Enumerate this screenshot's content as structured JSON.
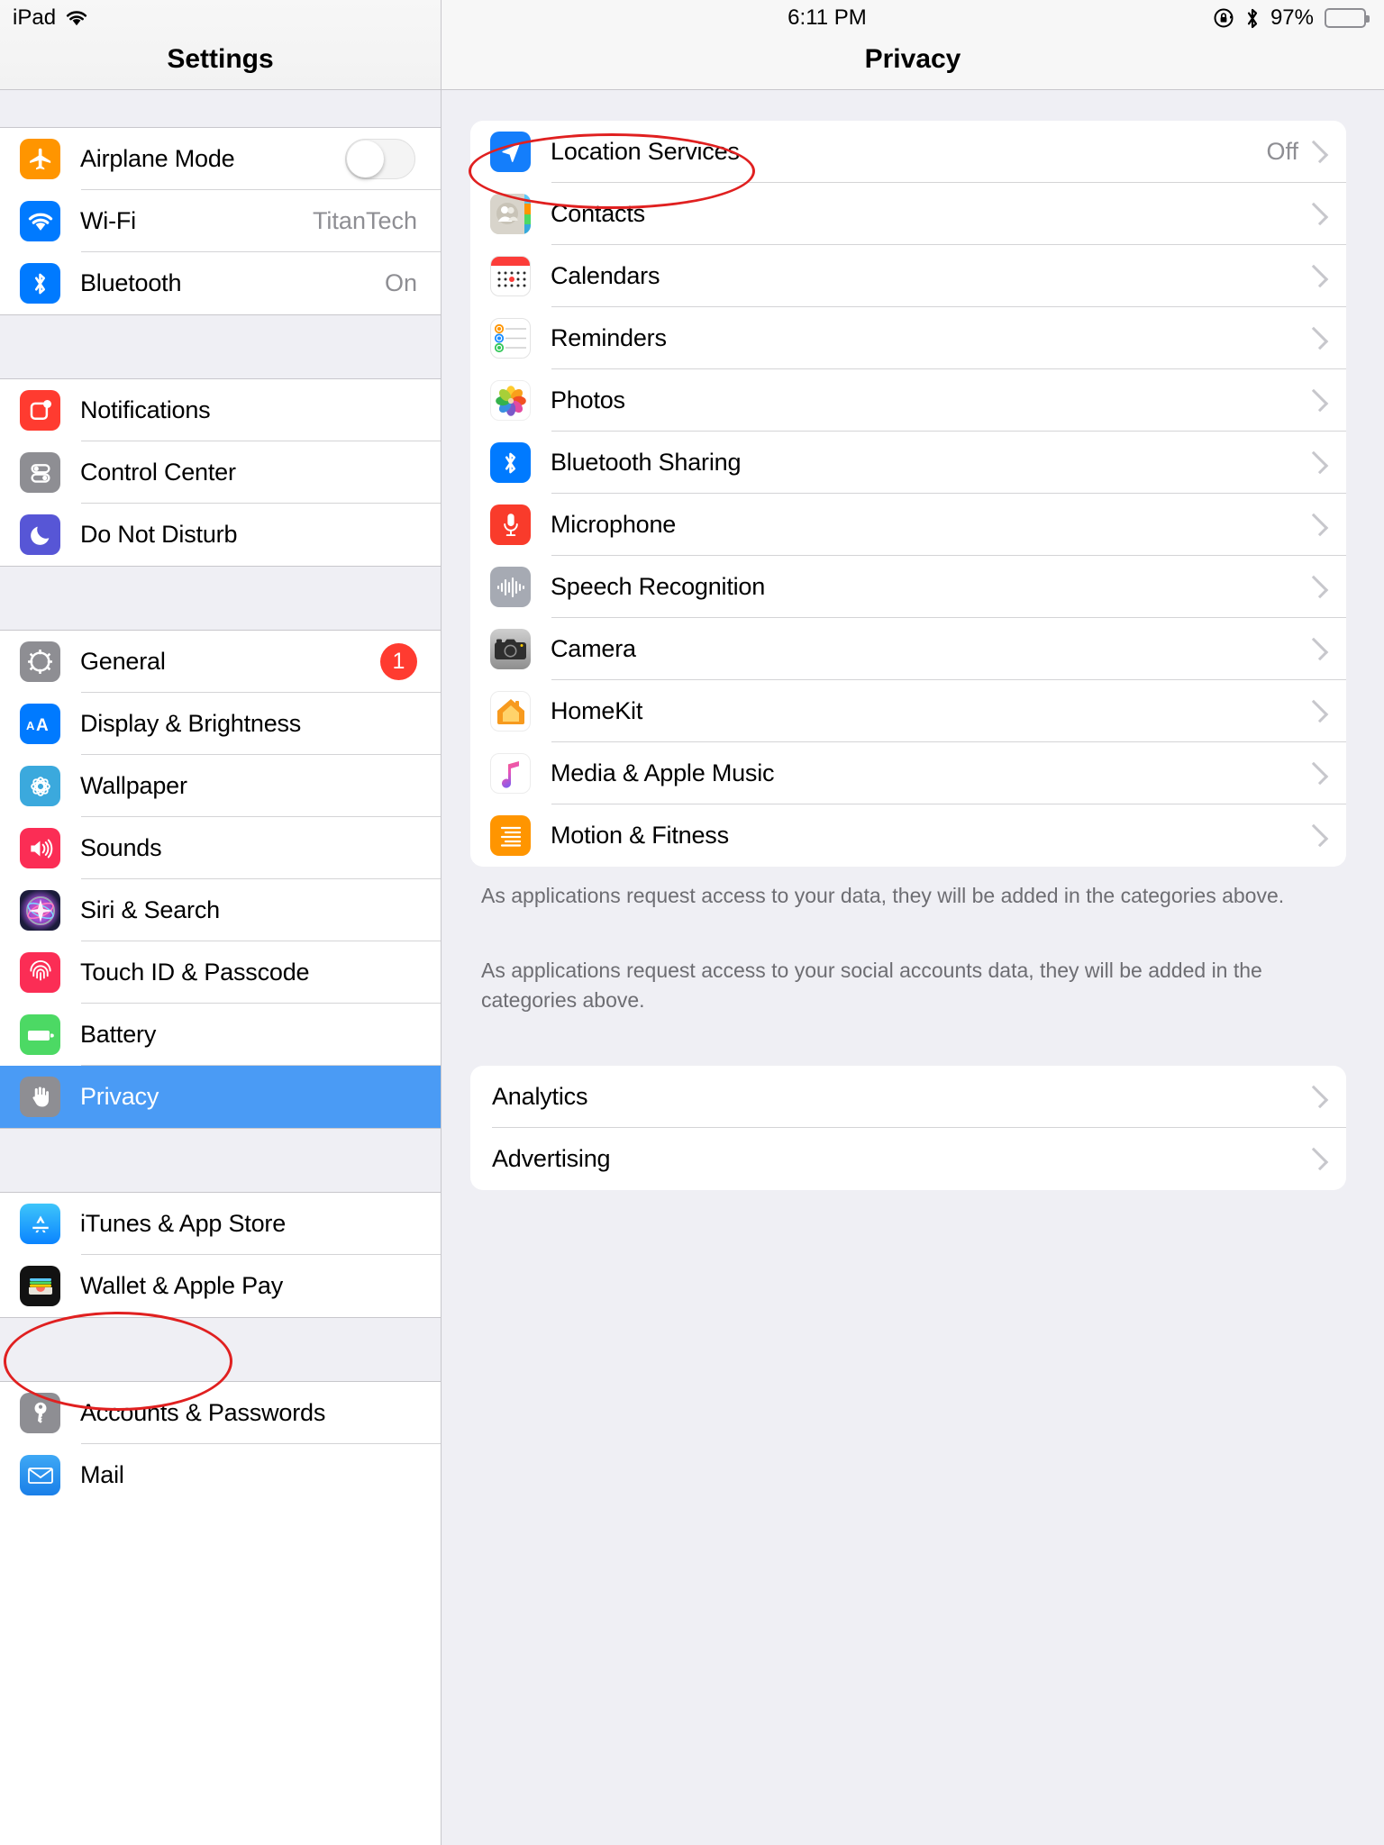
{
  "statusbar": {
    "device_label": "iPad",
    "wifi_icon": "wifi-icon",
    "time": "6:11 PM",
    "rotation_lock_icon": "rotation-lock-icon",
    "bluetooth_icon": "bluetooth-icon",
    "battery_percent": "97%",
    "battery_icon": "battery-icon"
  },
  "sidebar": {
    "title": "Settings",
    "groups": [
      {
        "items": [
          {
            "label": "Airplane Mode",
            "icon": "airplane-icon",
            "accessory": "toggle",
            "toggle_on": false
          },
          {
            "label": "Wi-Fi",
            "icon": "wifi-icon",
            "accessory": "value",
            "value": "TitanTech"
          },
          {
            "label": "Bluetooth",
            "icon": "bluetooth-icon",
            "accessory": "value",
            "value": "On"
          }
        ]
      },
      {
        "items": [
          {
            "label": "Notifications",
            "icon": "notifications-icon",
            "accessory": "none"
          },
          {
            "label": "Control Center",
            "icon": "control-center-icon",
            "accessory": "none"
          },
          {
            "label": "Do Not Disturb",
            "icon": "do-not-disturb-icon",
            "accessory": "none"
          }
        ]
      },
      {
        "items": [
          {
            "label": "General",
            "icon": "gear-icon",
            "accessory": "badge",
            "badge": "1"
          },
          {
            "label": "Display & Brightness",
            "icon": "display-brightness-icon",
            "accessory": "none"
          },
          {
            "label": "Wallpaper",
            "icon": "wallpaper-icon",
            "accessory": "none"
          },
          {
            "label": "Sounds",
            "icon": "sounds-icon",
            "accessory": "none"
          },
          {
            "label": "Siri & Search",
            "icon": "siri-icon",
            "accessory": "none"
          },
          {
            "label": "Touch ID & Passcode",
            "icon": "touch-id-icon",
            "accessory": "none"
          },
          {
            "label": "Battery",
            "icon": "battery-icon",
            "accessory": "none"
          },
          {
            "label": "Privacy",
            "icon": "privacy-hand-icon",
            "accessory": "none",
            "selected": true
          }
        ]
      },
      {
        "items": [
          {
            "label": "iTunes & App Store",
            "icon": "app-store-icon",
            "accessory": "none"
          },
          {
            "label": "Wallet & Apple Pay",
            "icon": "wallet-icon",
            "accessory": "none"
          }
        ]
      },
      {
        "items": [
          {
            "label": "Accounts & Passwords",
            "icon": "key-icon",
            "accessory": "none"
          },
          {
            "label": "Mail",
            "icon": "mail-icon",
            "accessory": "none"
          }
        ]
      }
    ]
  },
  "detail": {
    "title": "Privacy",
    "permissions": [
      {
        "label": "Location Services",
        "icon": "location-arrow-icon",
        "value": "Off",
        "chevron": true
      },
      {
        "label": "Contacts",
        "icon": "contacts-icon",
        "value": "",
        "chevron": true
      },
      {
        "label": "Calendars",
        "icon": "calendar-icon",
        "value": "",
        "chevron": true
      },
      {
        "label": "Reminders",
        "icon": "reminders-icon",
        "value": "",
        "chevron": true
      },
      {
        "label": "Photos",
        "icon": "photos-icon",
        "value": "",
        "chevron": true
      },
      {
        "label": "Bluetooth Sharing",
        "icon": "bluetooth-icon",
        "value": "",
        "chevron": true
      },
      {
        "label": "Microphone",
        "icon": "microphone-icon",
        "value": "",
        "chevron": true
      },
      {
        "label": "Speech Recognition",
        "icon": "speech-recognition-icon",
        "value": "",
        "chevron": true
      },
      {
        "label": "Camera",
        "icon": "camera-icon",
        "value": "",
        "chevron": true
      },
      {
        "label": "HomeKit",
        "icon": "homekit-icon",
        "value": "",
        "chevron": true
      },
      {
        "label": "Media & Apple Music",
        "icon": "apple-music-icon",
        "value": "",
        "chevron": true
      },
      {
        "label": "Motion & Fitness",
        "icon": "motion-fitness-icon",
        "value": "",
        "chevron": true
      }
    ],
    "footer_note_1": "As applications request access to your data, they will be added in the categories above.",
    "footer_note_2": "As applications request access to your social accounts data, they will be added in the categories above.",
    "extras": [
      {
        "label": "Analytics",
        "chevron": true
      },
      {
        "label": "Advertising",
        "chevron": true
      }
    ]
  },
  "annotations": {
    "accent_color": "#e02020",
    "marks": [
      {
        "name": "location-services-highlight",
        "shape": "ellipse"
      },
      {
        "name": "privacy-sidebar-highlight",
        "shape": "ellipse"
      }
    ]
  }
}
